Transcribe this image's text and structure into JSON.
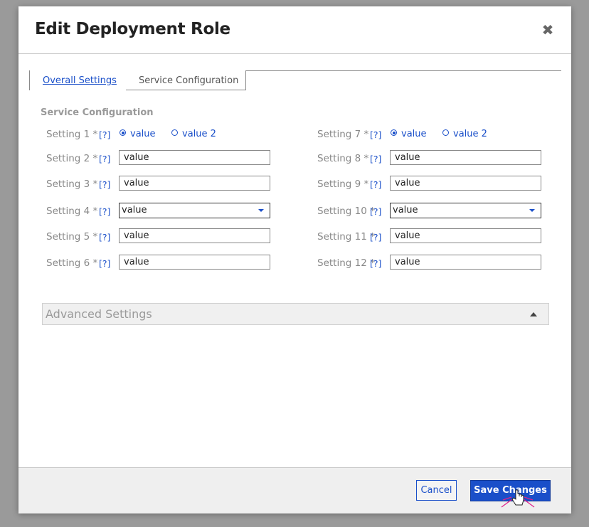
{
  "dialog": {
    "title": "Edit Deployment Role",
    "close_icon": "close-icon"
  },
  "tabs": [
    {
      "label": "Overall Settings",
      "active": true
    },
    {
      "label": "Service Configuration",
      "active": false
    }
  ],
  "section_title": "Service Configuration",
  "help_text": "[?]",
  "left_settings": [
    {
      "label": "Setting 1 *",
      "type": "radio",
      "options": [
        "value",
        "value 2"
      ],
      "selected": 0
    },
    {
      "label": "Setting 2 *",
      "type": "text",
      "value": "value"
    },
    {
      "label": "Setting 3 *",
      "type": "text",
      "value": "value"
    },
    {
      "label": "Setting 4 *",
      "type": "select",
      "value": "value"
    },
    {
      "label": "Setting 5 *",
      "type": "text",
      "value": "value"
    },
    {
      "label": "Setting 6 *",
      "type": "text",
      "value": "value"
    }
  ],
  "right_settings": [
    {
      "label": "Setting 7 *",
      "type": "radio",
      "options": [
        "value",
        "value 2"
      ],
      "selected": 0
    },
    {
      "label": "Setting 8 *",
      "type": "text",
      "value": "value"
    },
    {
      "label": "Setting 9 *",
      "type": "text",
      "value": "value"
    },
    {
      "label": "Setting 10 *",
      "type": "select",
      "value": "value"
    },
    {
      "label": "Setting 11 *",
      "type": "text",
      "value": "value"
    },
    {
      "label": "Setting 12 *",
      "type": "text",
      "value": "value"
    }
  ],
  "advanced": {
    "label": "Advanced Settings",
    "expanded": false
  },
  "footer": {
    "cancel_label": "Cancel",
    "save_label": "Save Changes"
  },
  "colors": {
    "accent": "#1a4fc9",
    "cursor": "#e0208a"
  }
}
